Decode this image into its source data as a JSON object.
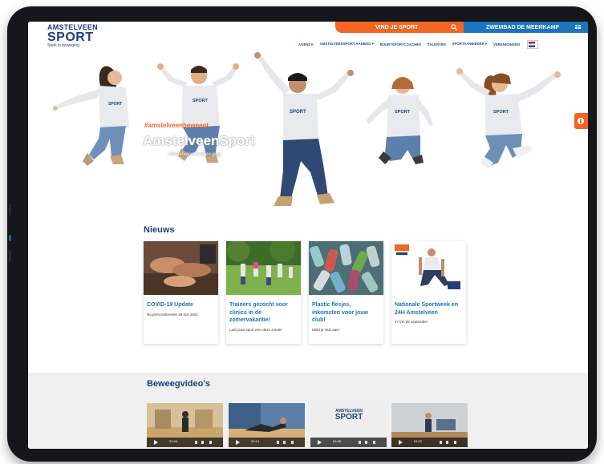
{
  "header": {
    "logo": {
      "line1": "AMSTELVEEN",
      "line2": "SPORT",
      "line3": "Sterk in beweging"
    },
    "top_orange": {
      "label": "VIND JE SPORT",
      "icon": "search-icon",
      "color": "#f26522"
    },
    "top_blue": {
      "label": "ZWEMBAD DE MEERKAMP",
      "icon": "grid-icon",
      "color": "#1c75bc"
    },
    "nav": [
      "AGENDA",
      "AMSTELVEENSPORT AANBOD ▾",
      "BUURTSPORTCOACHES",
      "TALENTEN",
      "SPORTAANBIEDER ▾",
      "VERENIGINGEN"
    ],
    "language_flag": "netherlands-flag-icon"
  },
  "hero": {
    "hashtag": "#amstelveenbeweegt",
    "title": "AmstelveenSport",
    "subtitle": "Amstelveen in beweging"
  },
  "news": {
    "title": "Nieuws",
    "cards": [
      {
        "title": "COVID-19 Update",
        "desc": "Na persconferentie 28 mei 2021"
      },
      {
        "title": "Trainers gezocht voor clinics in de zomervakantie!",
        "desc": "Laat jouw sport zien deze zomer!"
      },
      {
        "title": "Plastic flesjes, inkomsten voor jouw club!",
        "desc": "Meld je club aan!"
      },
      {
        "title": "Nationale Sportweek en 24H Amstelveen",
        "desc": "17 t/m 26 september"
      }
    ]
  },
  "videos": {
    "title": "Beweegvideo's",
    "items": [
      {
        "time": "01:46"
      },
      {
        "time": "02:14"
      },
      {
        "time": "01:55",
        "logo_top": "AMSTELVEEN",
        "logo_main": "SPORT"
      },
      {
        "time": "01:32"
      }
    ]
  }
}
